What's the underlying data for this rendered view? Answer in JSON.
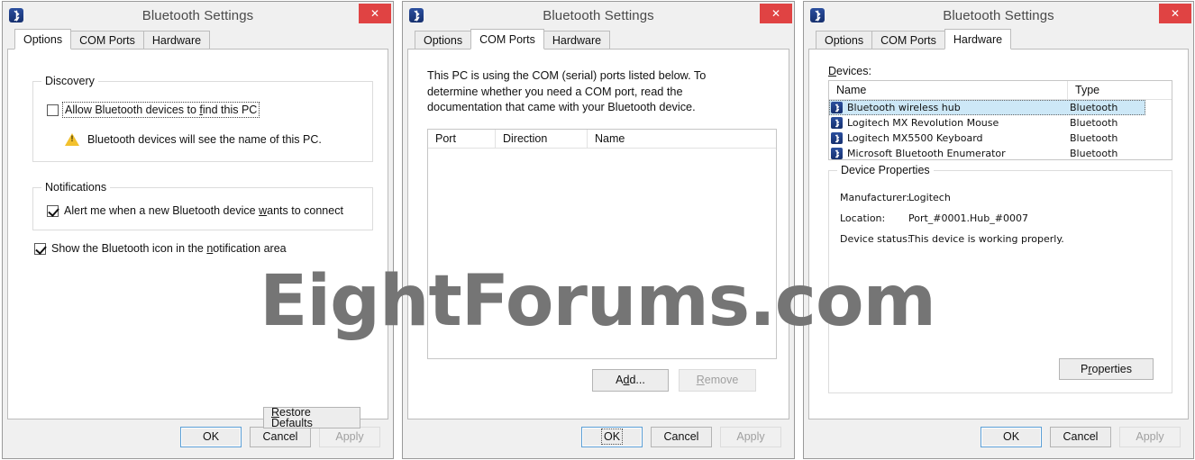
{
  "watermark": "EightForums.com",
  "common": {
    "title": "Bluetooth Settings",
    "close_label": "✕",
    "bluetooth_icon": "bluetooth-icon",
    "buttons": {
      "ok": "OK",
      "cancel": "Cancel",
      "apply": "Apply"
    },
    "tabs": [
      "Options",
      "COM Ports",
      "Hardware"
    ]
  },
  "colors": {
    "titlebar": "#f0f0f0",
    "close_red": "#e04343",
    "accent_blue": "#5b9fd6",
    "selection": "#cde8f7",
    "bluetooth_blue": "#1f3f87",
    "warning_yellow": "#f2c12e",
    "watermark_gray": "#757575"
  },
  "window_options": {
    "title": "Bluetooth Settings",
    "active_tab": "Options",
    "tabs": [
      "Options",
      "COM Ports",
      "Hardware"
    ],
    "discovery": {
      "legend": "Discovery",
      "checkbox_label": "Allow Bluetooth devices to find this PC",
      "checkbox_accel": "f",
      "checkbox_checked": false,
      "warning_text": "Bluetooth devices will see the name of this PC."
    },
    "notifications": {
      "legend": "Notifications",
      "checkbox_label": "Alert me when a new Bluetooth device wants to connect",
      "checkbox_accel": "w",
      "checkbox_checked": true
    },
    "show_icon": {
      "label": "Show the Bluetooth icon in the notification area",
      "accel": "n",
      "checked": true
    },
    "restore_defaults": "Restore Defaults",
    "restore_defaults_accel": "R",
    "footer": {
      "ok": "OK",
      "cancel": "Cancel",
      "apply": "Apply"
    }
  },
  "window_comports": {
    "title": "Bluetooth Settings",
    "active_tab": "COM Ports",
    "tabs": [
      "Options",
      "COM Ports",
      "Hardware"
    ],
    "description": "This PC is using the COM (serial) ports listed below. To determine whether you need a COM port, read the documentation that came with your Bluetooth device.",
    "columns": [
      "Port",
      "Direction",
      "Name"
    ],
    "rows": [],
    "add_button": "Add...",
    "add_accel": "d",
    "remove_button": "Remove",
    "remove_accel": "R",
    "remove_disabled": true,
    "footer": {
      "ok": "OK",
      "cancel": "Cancel",
      "apply": "Apply"
    }
  },
  "window_hardware": {
    "title": "Bluetooth Settings",
    "active_tab": "Hardware",
    "tabs": [
      "Options",
      "COM Ports",
      "Hardware"
    ],
    "devices_label": "Devices:",
    "devices_accel": "D",
    "columns": [
      "Name",
      "Type"
    ],
    "devices": [
      {
        "name": "Bluetooth wireless hub",
        "type": "Bluetooth",
        "selected": true
      },
      {
        "name": "Logitech MX Revolution Mouse",
        "type": "Bluetooth",
        "selected": false
      },
      {
        "name": "Logitech MX5500 Keyboard",
        "type": "Bluetooth",
        "selected": false
      },
      {
        "name": "Microsoft Bluetooth Enumerator",
        "type": "Bluetooth",
        "selected": false
      }
    ],
    "properties": {
      "legend": "Device Properties",
      "manufacturer_label": "Manufacturer:",
      "manufacturer_value": "Logitech",
      "location_label": "Location:",
      "location_value": "Port_#0001.Hub_#0007",
      "status_label": "Device status:",
      "status_value": "This device is working properly."
    },
    "properties_button": "Properties",
    "properties_accel": "r",
    "footer": {
      "ok": "OK",
      "cancel": "Cancel",
      "apply": "Apply"
    }
  }
}
